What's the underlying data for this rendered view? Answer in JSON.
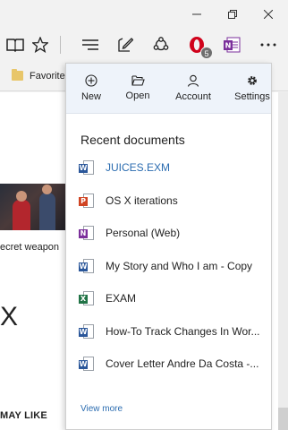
{
  "toolbar": {
    "icons": [
      "reading-view-icon",
      "favorite-star-icon",
      "hub-icon",
      "web-note-icon",
      "share-icon",
      "opera-icon",
      "onenote-icon",
      "more-icon"
    ],
    "opera_badge": "5"
  },
  "favorites": {
    "label": "Favorite"
  },
  "page_behind": {
    "caption": "ecret weapon",
    "big_letter": "X",
    "may_like": "MAY LIKE"
  },
  "panel": {
    "actions": [
      {
        "label": "New",
        "icon": "plus-circle-icon"
      },
      {
        "label": "Open",
        "icon": "folder-open-icon"
      },
      {
        "label": "Account",
        "icon": "person-icon"
      },
      {
        "label": "Settings",
        "icon": "gear-icon"
      }
    ],
    "recent_title": "Recent documents",
    "documents": [
      {
        "name": "JUICES.EXM",
        "type": "word",
        "color": "#2b579a"
      },
      {
        "name": "OS X iterations",
        "type": "powerpoint",
        "color": "#d04423"
      },
      {
        "name": "Personal (Web)",
        "type": "onenote",
        "color": "#7b2f9b"
      },
      {
        "name": "My Story and Who I am - Copy",
        "type": "word",
        "color": "#2b579a"
      },
      {
        "name": "EXAM",
        "type": "excel",
        "color": "#217346"
      },
      {
        "name": "How-To Track Changes In Wor...",
        "type": "word",
        "color": "#2b579a"
      },
      {
        "name": "Cover Letter Andre Da Costa -...",
        "type": "word",
        "color": "#2b579a"
      }
    ],
    "view_more": "View more"
  },
  "colors": {
    "link": "#2b6cb0",
    "onenote": "#7b2f9b",
    "opera": "#d0021b"
  }
}
